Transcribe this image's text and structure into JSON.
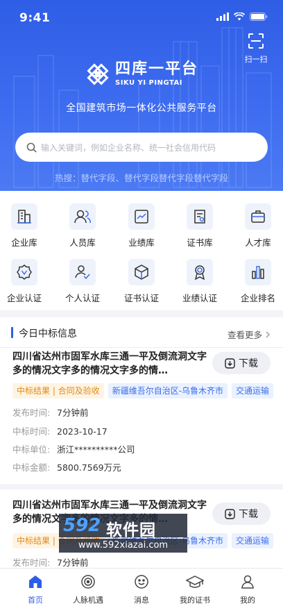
{
  "status_bar": {
    "time": "9:41"
  },
  "header": {
    "scan_label": "扫一扫",
    "logo_cn": "四库一平台",
    "logo_en": "SIKU YI PINGTAI",
    "slogan": "全国建筑市场一体化公共服务平台",
    "search_placeholder": "输入关键词，例如企业名称、统一社会信用代码",
    "hot_search": "热搜：替代字段、替代字段替代字段替代字段",
    "colors": {
      "primary": "#2f5ee6",
      "background": "#f3f4f7"
    }
  },
  "grid": {
    "items": [
      {
        "label": "企业库",
        "icon": "building-icon"
      },
      {
        "label": "人员库",
        "icon": "people-icon"
      },
      {
        "label": "业绩库",
        "icon": "chart-icon"
      },
      {
        "label": "证书库",
        "icon": "certificate-icon"
      },
      {
        "label": "人才库",
        "icon": "briefcase-icon"
      },
      {
        "label": "企业认证",
        "icon": "badge-check-icon"
      },
      {
        "label": "个人认证",
        "icon": "user-check-icon"
      },
      {
        "label": "证书认证",
        "icon": "cube-icon"
      },
      {
        "label": "业绩认证",
        "icon": "medal-icon"
      },
      {
        "label": "企业排名",
        "icon": "bar-rank-icon"
      }
    ]
  },
  "news": {
    "section_title": "今日中标信息",
    "more_label": "查看更多",
    "download_label": "下载",
    "items": [
      {
        "title": "四川省达州市固军水库三通一平及倒流洞文字多的情况文字多的情况文字多的情…",
        "tags": [
          "中标结果 | 合同及验收",
          "新疆维吾尔自治区-乌鲁木齐市",
          "交通运输"
        ],
        "publish_label": "发布时间:",
        "publish_value": "7分钟前",
        "bid_time_label": "中标时间:",
        "bid_time_value": "2023-10-17",
        "bid_unit_label": "中标单位:",
        "bid_unit_value": "浙江**********公司",
        "amount_label": "中标金额:",
        "amount_value": "5800.7569万元"
      },
      {
        "title": "四川省达州市固军水库三通一平及倒流洞文字多的情况文字多的情况文字多的情…",
        "tags": [
          "中标结果 | 合同及验收",
          "新疆维吾尔自治区-乌鲁木齐市",
          "交通运输"
        ],
        "publish_label": "发布时间:",
        "publish_value": "7分钟前"
      }
    ]
  },
  "watermark": {
    "brand_num": "592",
    "brand_cn": "软件园",
    "url": "www.592xiazai.com"
  },
  "tabbar": {
    "items": [
      {
        "label": "首页",
        "icon": "home-icon"
      },
      {
        "label": "人脉机遇",
        "icon": "compass-icon"
      },
      {
        "label": "消息",
        "icon": "message-icon"
      },
      {
        "label": "我的证书",
        "icon": "graduation-icon"
      },
      {
        "label": "我的",
        "icon": "profile-icon"
      }
    ]
  }
}
